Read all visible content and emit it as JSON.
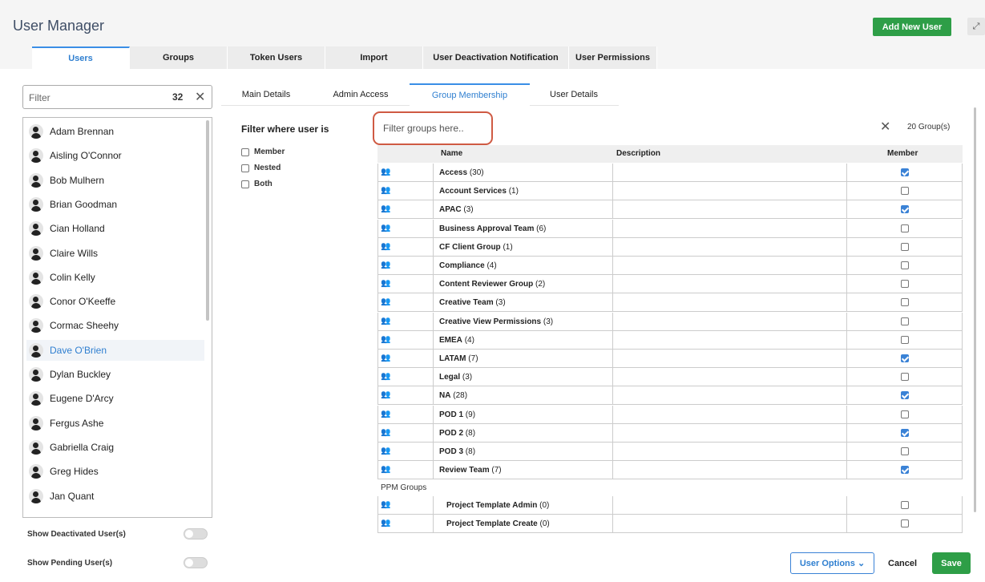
{
  "header": {
    "title": "User Manager",
    "add_user_label": "Add New User",
    "expand_icon": "expand-icon"
  },
  "tabs": [
    {
      "label": "Users",
      "active": true
    },
    {
      "label": "Groups"
    },
    {
      "label": "Token Users"
    },
    {
      "label": "Import"
    },
    {
      "label": "User Deactivation Notification"
    },
    {
      "label": "User Permissions"
    }
  ],
  "user_filter": {
    "placeholder": "Filter",
    "count": "32"
  },
  "users": [
    "Adam Brennan",
    "Aisling O'Connor",
    "Bob Mulhern",
    "Brian Goodman",
    "Cian Holland",
    "Claire Wills",
    "Colin Kelly",
    "Conor O'Keeffe",
    "Cormac Sheehy",
    "Dave O'Brien",
    "Dylan Buckley",
    "Eugene D'Arcy",
    "Fergus Ashe",
    "Gabriella Craig",
    "Greg Hides",
    "Jan Quant"
  ],
  "selected_user": "Dave O'Brien",
  "toggles": {
    "deactivated": "Show Deactivated User(s)",
    "pending": "Show Pending User(s)"
  },
  "subtabs": [
    "Main Details",
    "Admin Access",
    "Group Membership",
    "User Details"
  ],
  "membership_filter": {
    "title": "Filter where user is",
    "options": [
      "Member",
      "Nested",
      "Both"
    ]
  },
  "group_filter": {
    "placeholder": "Filter groups here..",
    "count": "20 Group(s)"
  },
  "table": {
    "headers": {
      "name": "Name",
      "description": "Description",
      "member": "Member"
    }
  },
  "groups": [
    {
      "name": "Access",
      "count": "(30)",
      "member": true
    },
    {
      "name": "Account Services",
      "count": "(1)",
      "member": false
    },
    {
      "name": "APAC",
      "count": "(3)",
      "member": true
    },
    {
      "name": "Business Approval Team",
      "count": "(6)",
      "member": false
    },
    {
      "name": "CF Client Group",
      "count": "(1)",
      "member": false
    },
    {
      "name": "Compliance",
      "count": "(4)",
      "member": false
    },
    {
      "name": "Content Reviewer Group",
      "count": "(2)",
      "member": false
    },
    {
      "name": "Creative Team",
      "count": "(3)",
      "member": false
    },
    {
      "name": "Creative View Permissions",
      "count": "(3)",
      "member": false
    },
    {
      "name": "EMEA",
      "count": "(4)",
      "member": false
    },
    {
      "name": "LATAM",
      "count": "(7)",
      "member": true
    },
    {
      "name": "Legal",
      "count": "(3)",
      "member": false
    },
    {
      "name": "NA",
      "count": "(28)",
      "member": true
    },
    {
      "name": "POD 1",
      "count": "(9)",
      "member": false
    },
    {
      "name": "POD 2",
      "count": "(8)",
      "member": true
    },
    {
      "name": "POD 3",
      "count": "(8)",
      "member": false
    },
    {
      "name": "Review Team",
      "count": "(7)",
      "member": true
    }
  ],
  "ppm_label": "PPM Groups",
  "ppm_groups": [
    {
      "name": "Project Template Admin",
      "count": "(0)",
      "member": false
    },
    {
      "name": "Project Template Create",
      "count": "(0)",
      "member": false
    }
  ],
  "footer": {
    "user_options": "User Options ⌄",
    "cancel": "Cancel",
    "save": "Save"
  }
}
